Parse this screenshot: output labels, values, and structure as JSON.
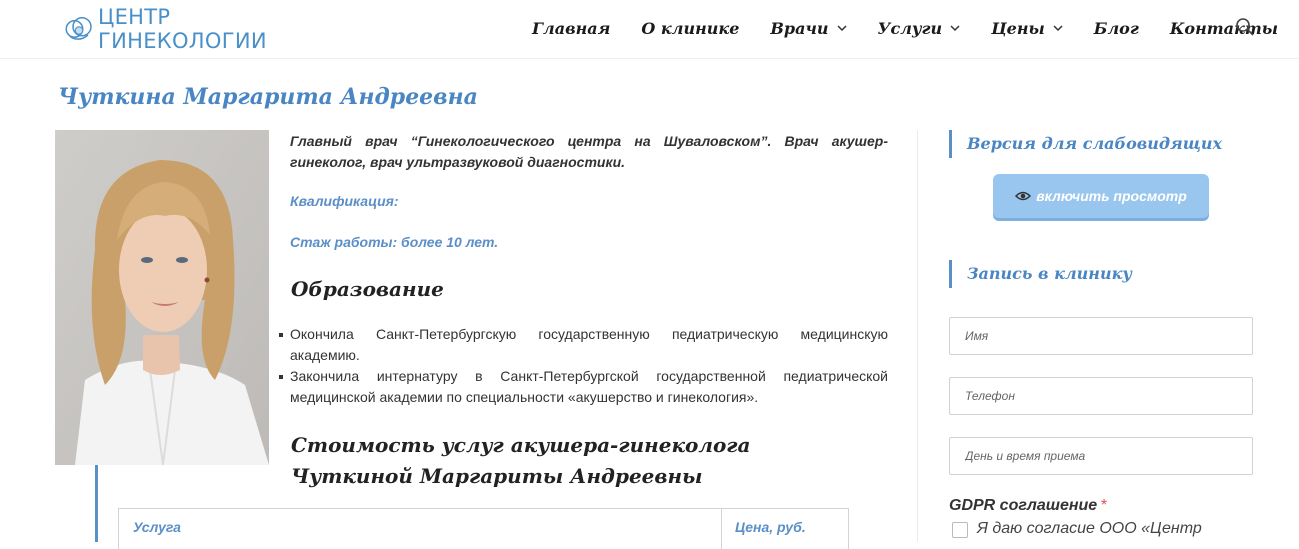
{
  "logo": {
    "text": "ЦЕНТР ГИНЕКОЛОГИИ",
    "color": "#4a90c8"
  },
  "nav": {
    "items": [
      "Главная",
      "О клинике",
      "Врачи",
      "Услуги",
      "Цены",
      "Блог",
      "Контакты"
    ],
    "dropdowns": [
      "Врачи",
      "Услуги",
      "Цены"
    ]
  },
  "page": {
    "title": "Чуткина Маргарита Андреевна"
  },
  "profile": {
    "intro": "Главный врач “Гинекологического центра на Шуваловском”. Врач акушер-гинеколог, врач ультразвуковой диагностики.",
    "qualification_label": "Квалификация:",
    "experience": "Стаж работы: более 10 лет.",
    "education_heading": "Образование",
    "education": [
      "Окончила Санкт-Петербургскую государственную педиатрическую медицинскую академию.",
      "Закончила интернатуру в Санкт-Петербургской государственной педиатрической медицинской академии по специальности «акушерство и гинекология»."
    ],
    "price_heading": "Стоимость услуг акушера-гинеколога Чуткиной Маргариты Андреевны"
  },
  "price_table": {
    "headers": [
      "Услуга",
      "Цена, руб."
    ]
  },
  "sidebar": {
    "vision_heading": "Версия для слабовидящих",
    "vision_button": "включить просмотр",
    "booking_heading": "Запись в клинику",
    "fields": {
      "name_placeholder": "Имя",
      "phone_placeholder": "Телефон",
      "datetime_placeholder": "День и время приема"
    },
    "gdpr_label": "GDPR соглашение",
    "gdpr_required": "*",
    "gdpr_consent": "Я даю согласие ООО «Центр"
  },
  "colors": {
    "accent": "#5b8fc7",
    "title": "#4a86c4",
    "button": "#99c6ee",
    "required": "#d9534f"
  }
}
